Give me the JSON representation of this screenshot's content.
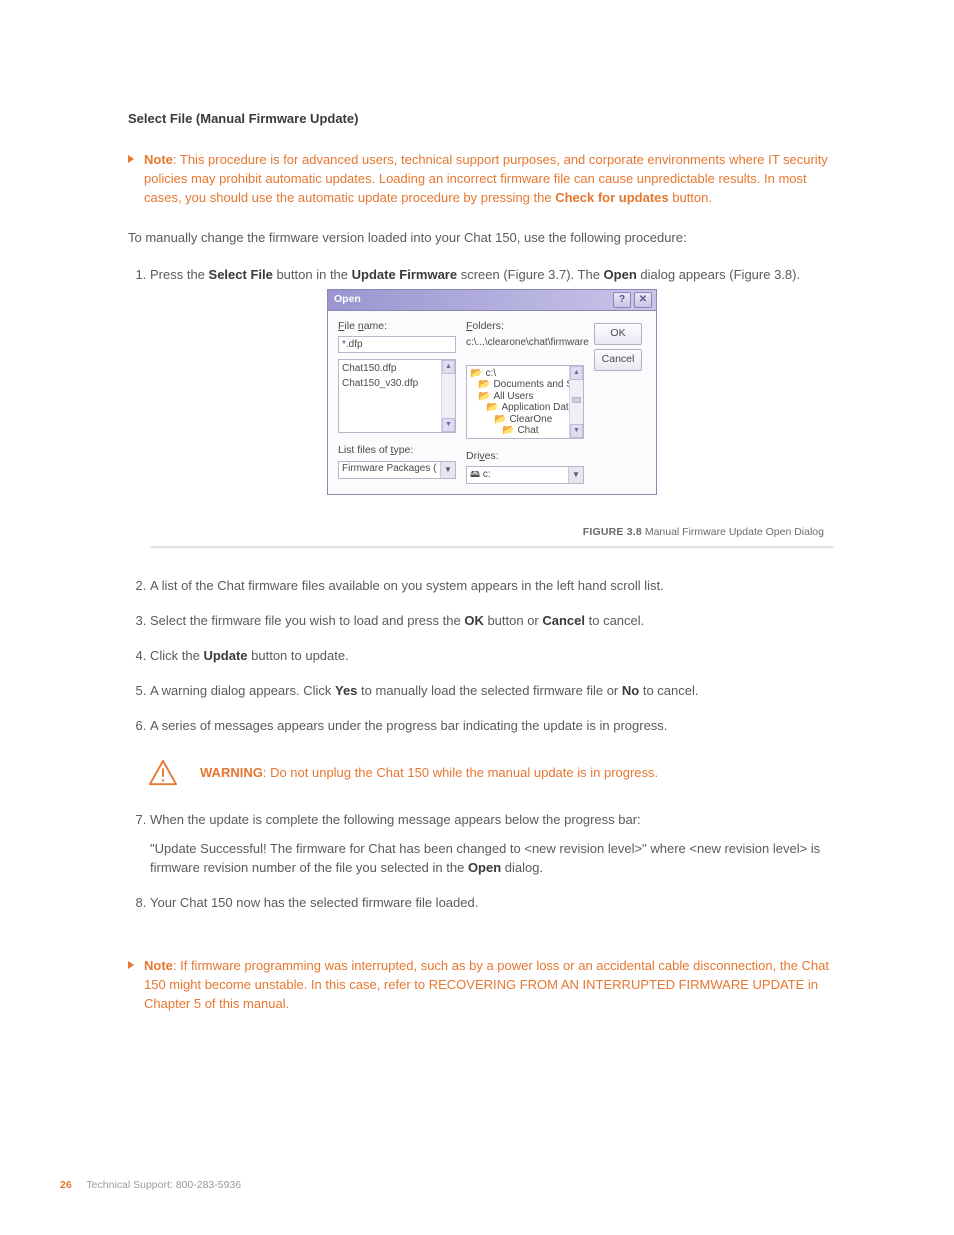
{
  "section_title": "Select File (Manual Firmware Update)",
  "note1": {
    "label": "Note",
    "text_before": ": This procedure is for advanced users, technical support purposes, and corporate environments where IT security policies may prohibit automatic updates. Loading an incorrect firmware file can cause unpredictable results. In most cases, you should use the automatic update procedure by pressing the ",
    "bold_end": "Check for updates",
    "text_after": " button."
  },
  "intro": "To manually change the firmware version loaded into your Chat 150, use the following procedure:",
  "step1": {
    "a": "Press the ",
    "b": "Select File",
    "c": " button in the ",
    "d": "Update Firmware",
    "e": " screen (Figure 3.7). The ",
    "f": "Open",
    "g": " dialog appears (Figure 3.8)."
  },
  "dialog": {
    "title": "Open",
    "help": "?",
    "close": "✕",
    "file_name_label": "File name:",
    "file_name_value": "*.dfp",
    "file_list": [
      "Chat150.dfp",
      "Chat150_v30.dfp"
    ],
    "list_type_label": "List files of type:",
    "list_type_value": "Firmware Packages (*.dfp)",
    "folders_label": "Folders:",
    "folders_path": "c:\\...\\clearone\\chat\\firmware",
    "folder_tree": [
      {
        "name": "c:\\",
        "indent": 0
      },
      {
        "name": "Documents and Set",
        "indent": 1
      },
      {
        "name": "All Users",
        "indent": 1
      },
      {
        "name": "Application Data",
        "indent": 2
      },
      {
        "name": "ClearOne",
        "indent": 3
      },
      {
        "name": "Chat",
        "indent": 4
      }
    ],
    "drives_label": "Drives:",
    "drives_value": "c:",
    "ok": "OK",
    "cancel": "Cancel"
  },
  "caption": {
    "fig": "FIGURE 3.8",
    "text": " Manual Firmware Update Open Dialog"
  },
  "step2": "A list of the Chat firmware files available on you system appears in the left hand scroll list.",
  "step3": {
    "a": "Select the firmware file you wish to load and press the ",
    "b": "OK",
    "c": " button or ",
    "d": "Cancel",
    "e": " to cancel."
  },
  "step4": {
    "a": "Click the ",
    "b": "Update",
    "c": " button to update."
  },
  "step5": {
    "a": "A warning dialog appears. Click ",
    "b": "Yes",
    "c": " to manually load the selected firmware file or ",
    "d": "No",
    "e": " to cancel."
  },
  "step6": "A series of messages appears under the progress bar indicating the update is in progress.",
  "warning": {
    "label": "WARNING",
    "text": ": Do not unplug the Chat 150 while the manual update is in progress."
  },
  "step7": {
    "line1": "When the update is complete the following message appears below the progress bar:",
    "line2a": "\"Update Successful! The firmware for Chat has been changed to <new revision level>\" where <new revision level> is firmware revision number of the file you selected in the ",
    "line2b": "Open",
    "line2c": " dialog."
  },
  "step8": "Your Chat 150 now has the selected firmware file loaded.",
  "note2": {
    "label": "Note",
    "text": ": If firmware programming was interrupted, such as by a power loss or an accidental cable disconnection, the Chat 150 might become unstable.  In this case, refer to RECOVERING FROM AN INTERRUPTED FIRMWARE UPDATE in Chapter 5 of this manual."
  },
  "footer": {
    "page": "26",
    "text": "Technical Support: 800-283-5936"
  }
}
